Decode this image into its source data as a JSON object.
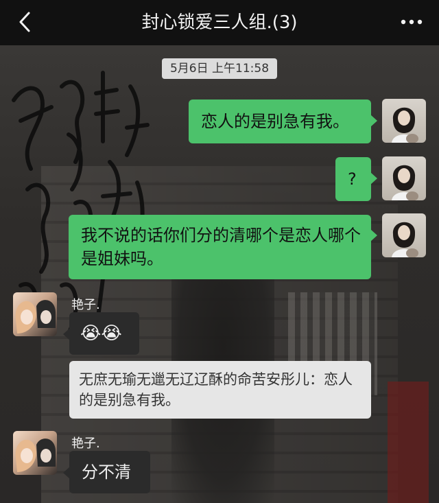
{
  "header": {
    "title": "封心锁爱三人组.(3)",
    "back_icon": "chevron-left-icon",
    "more_icon": "more-dots-icon"
  },
  "timestamp": "5月6日 上午11:58",
  "messages": [
    {
      "side": "right",
      "text": "恋人的是别急有我。"
    },
    {
      "side": "right",
      "text": "?"
    },
    {
      "side": "right",
      "text": "我不说的话你们分的清哪个是恋人哪个是姐妹吗。"
    },
    {
      "side": "left",
      "sender": "艳子.",
      "text": "😭😭"
    },
    {
      "side": "quote",
      "text": "无庶无瑜无邋无辽辽酥的命苦安彤儿：恋人的是别急有我。"
    },
    {
      "side": "left",
      "sender": "艳子.",
      "text": "分不清"
    }
  ],
  "colors": {
    "header_bg": "#111111",
    "self_bubble": "#4cc26b",
    "other_bubble": "#2b2b2b",
    "quote_bubble": "#e6e6e6",
    "timestamp_bg": "#dcdcdc"
  }
}
